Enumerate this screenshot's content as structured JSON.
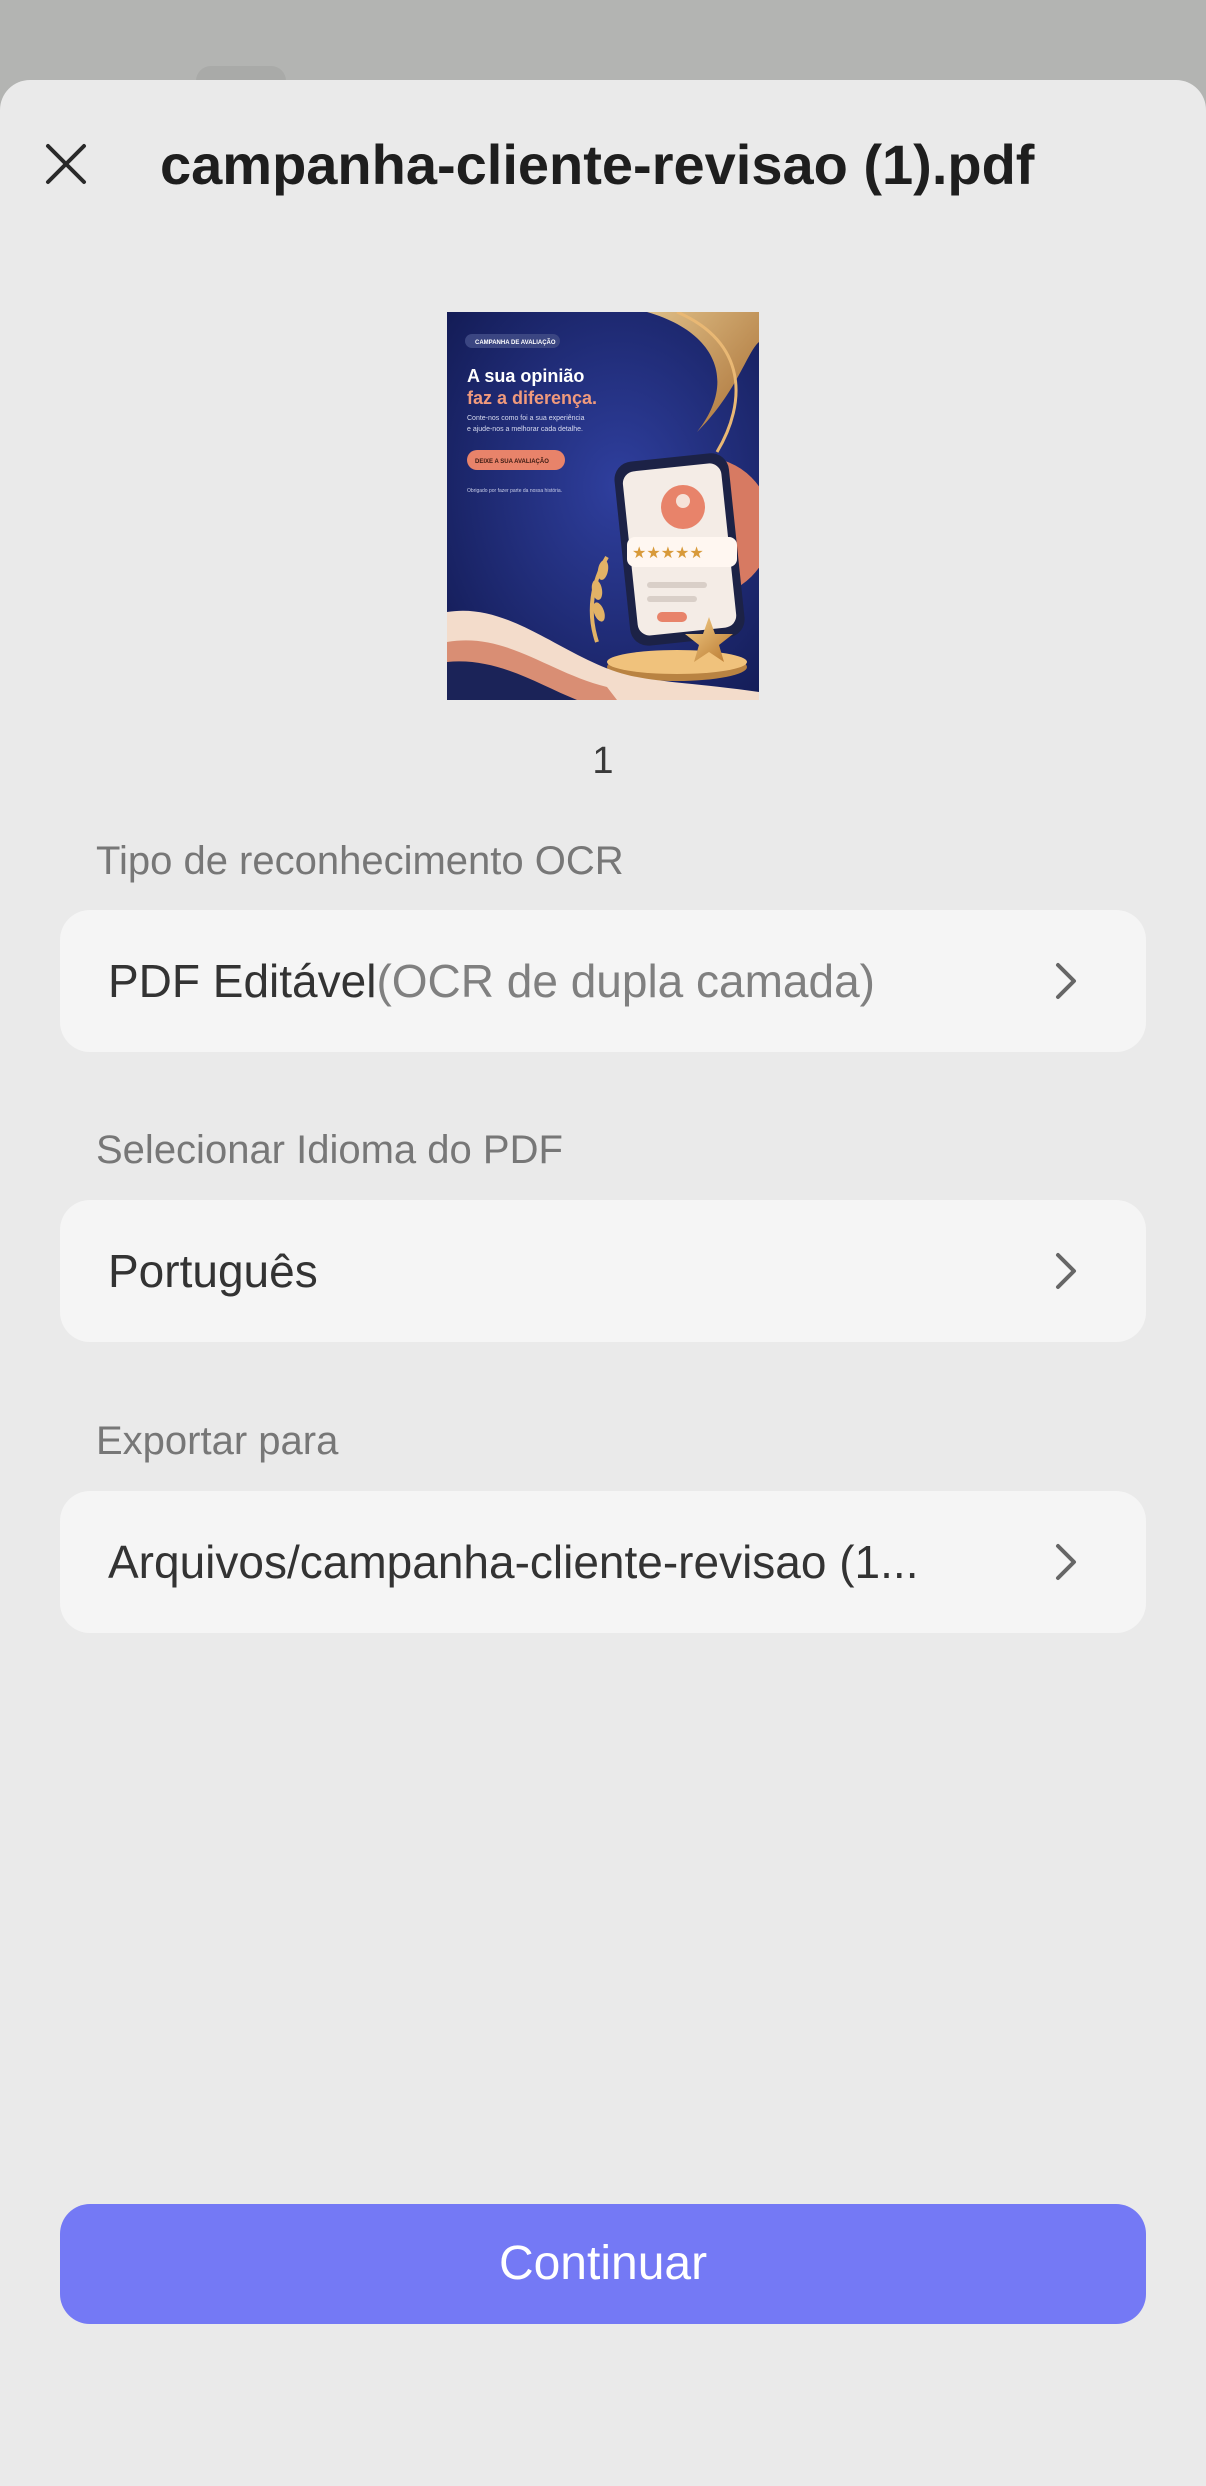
{
  "header": {
    "title": "campanha-cliente-revisao (1).pdf"
  },
  "preview": {
    "page_number": "1",
    "thumbnail": {
      "badge": "CAMPANHA DE AVALIAÇÃO",
      "headline_1": "A sua opinião",
      "headline_2": "faz a diferença.",
      "body_1": "Conte-nos como foi a sua experiência",
      "body_2": "e ajude-nos a melhorar cada detalhe.",
      "cta": "DEIXE A SUA AVALIAÇÃO",
      "footer": "Obrigado por fazer parte da nossa história.",
      "stars": "★★★★★",
      "rating_stars": 5
    }
  },
  "ocr": {
    "label": "Tipo de reconhecimento OCR",
    "value_main": "PDF Editável",
    "value_sub": "(OCR de dupla camada)"
  },
  "language": {
    "label": "Selecionar Idioma do PDF",
    "value": "Português"
  },
  "export": {
    "label": "Exportar para",
    "value": "Arquivos/campanha-cliente-revisao (1..."
  },
  "footer": {
    "continue_label": "Continuar"
  },
  "colors": {
    "accent": "#7479f5",
    "sheet_background": "#eaeaea",
    "field_background": "#f5f5f5"
  },
  "icons": [
    "close-icon",
    "chevron-right-icon"
  ]
}
